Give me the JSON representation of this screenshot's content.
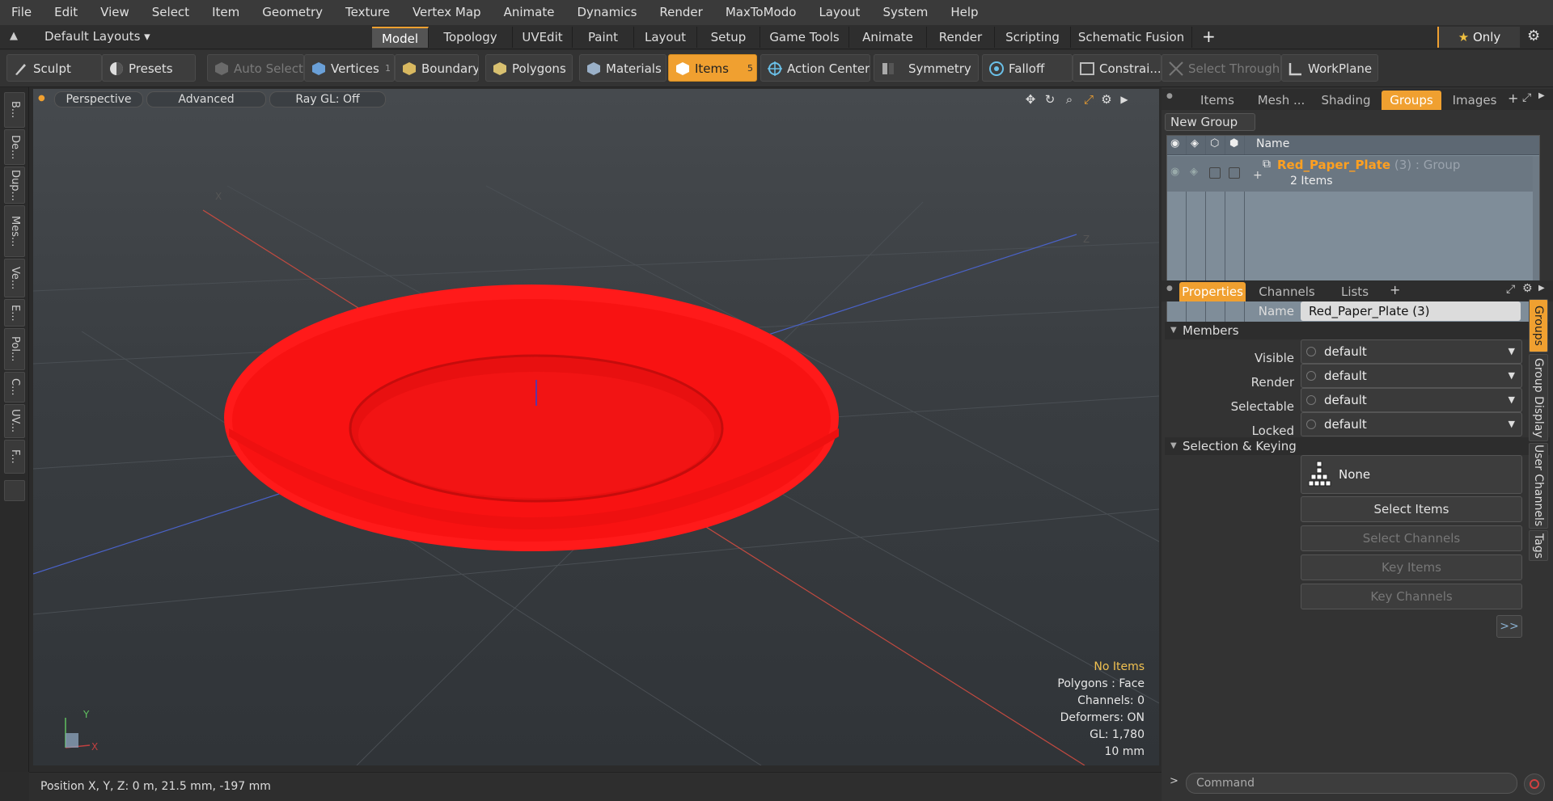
{
  "menu": [
    "File",
    "Edit",
    "View",
    "Select",
    "Item",
    "Geometry",
    "Texture",
    "Vertex Map",
    "Animate",
    "Dynamics",
    "Render",
    "MaxToModo",
    "Layout",
    "System",
    "Help"
  ],
  "layout_bar": {
    "layouts_label": "Default Layouts",
    "tabs": [
      "Model",
      "Topology",
      "UVEdit",
      "Paint",
      "Layout",
      "Setup",
      "Game Tools",
      "Animate",
      "Render",
      "Scripting",
      "Schematic Fusion"
    ],
    "active_tab": "Model",
    "add_label": "+",
    "only_label": "Only"
  },
  "toolbar": {
    "sculpt": "Sculpt",
    "presets": "Presets",
    "auto_select": "Auto Select",
    "vertices": "Vertices",
    "vertices_count": "1",
    "boundary": "Boundary",
    "polygons": "Polygons",
    "materials": "Materials",
    "items": "Items",
    "items_count": "5",
    "action_center": "Action Center",
    "symmetry": "Symmetry",
    "falloff": "Falloff",
    "constraints": "Constrai...",
    "select_through": "Select Through",
    "workplane": "WorkPlane"
  },
  "left_tabs": [
    "B...",
    "De...",
    "Dup...",
    "Mes...",
    "Ve...",
    "E...",
    "Pol...",
    "C...",
    "UV...",
    "F..."
  ],
  "viewport": {
    "view_mode": "Perspective",
    "advanced": "Advanced",
    "raygl": "Ray GL: Off",
    "hud": {
      "no_items": "No Items",
      "polygons": "Polygons : Face",
      "channels": "Channels: 0",
      "deformers": "Deformers: ON",
      "gl": "GL: 1,780",
      "scale": "10 mm"
    },
    "axis_x": "X",
    "axis_y": "Y",
    "axis_z": "Z"
  },
  "status": {
    "position": "Position X, Y, Z:   0 m, 21.5 mm, -197 mm"
  },
  "groups_panel": {
    "tabs": [
      "Items",
      "Mesh ...",
      "Shading",
      "Groups",
      "Images"
    ],
    "active_tab": "Groups",
    "new_group": "New Group",
    "col_name": "Name",
    "group_name": "Red_Paper_Plate",
    "group_count": "(3)",
    "group_type": ": Group",
    "group_items": "2 Items"
  },
  "properties": {
    "tabs": [
      "Properties",
      "Channels",
      "Lists"
    ],
    "active_tab": "Properties",
    "name_label": "Name",
    "name_value": "Red_Paper_Plate (3)",
    "members_section": "Members",
    "visible_label": "Visible",
    "render_label": "Render",
    "selectable_label": "Selectable",
    "locked_label": "Locked",
    "default_value": "default",
    "selection_section": "Selection & Keying",
    "none_label": "None",
    "select_items": "Select Items",
    "select_channels": "Select Channels",
    "key_items": "Key Items",
    "key_channels": "Key Channels",
    "more": ">>",
    "side_tabs": [
      "Groups",
      "Group Display",
      "User Channels",
      "Tags"
    ]
  },
  "command": {
    "placeholder": "Command"
  },
  "colors": {
    "accent": "#f0a030",
    "plate": "#ff1a1a",
    "group_name": "#ffa020"
  }
}
